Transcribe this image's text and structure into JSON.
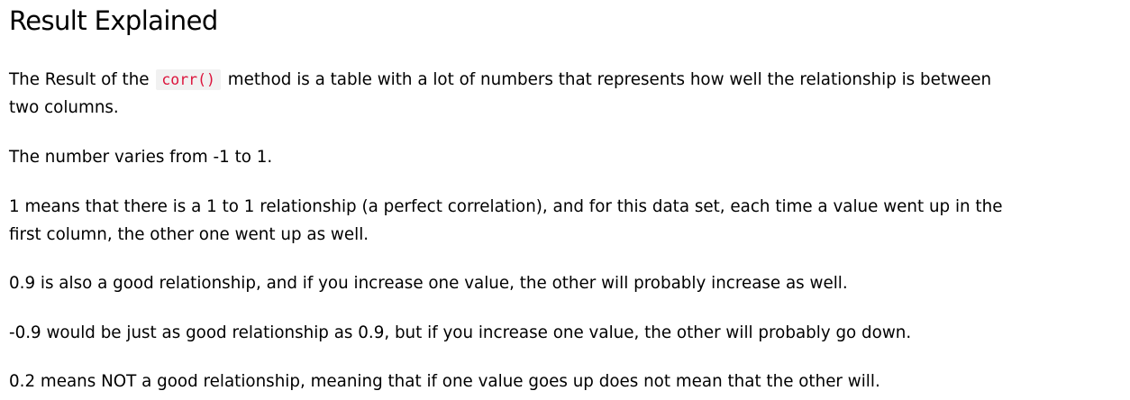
{
  "heading": "Result Explained",
  "paragraphs": {
    "p1": {
      "before": "The Result of the",
      "code": "corr()",
      "after_line1": "method is a table with a lot of numbers that represents how well the relationship is between",
      "line2": "two columns."
    },
    "p2": "The number varies from -1 to 1.",
    "p3": {
      "line1": "1 means that there is a 1 to 1 relationship (a perfect correlation), and for this data set, each time a value went up in the",
      "line2": "first column, the other one went up as well."
    },
    "p4": "0.9 is also a good relationship, and if you increase one value, the other will probably increase as well.",
    "p5": "-0.9 would be just as good relationship as 0.9, but if you increase one value, the other will probably go down.",
    "p6": "0.2 means NOT a good relationship, meaning that if one value goes up does not mean that the other will."
  },
  "colors": {
    "code_text": "#dc143c",
    "code_background": "#f1f1f1",
    "text": "#000000",
    "background": "#ffffff"
  }
}
